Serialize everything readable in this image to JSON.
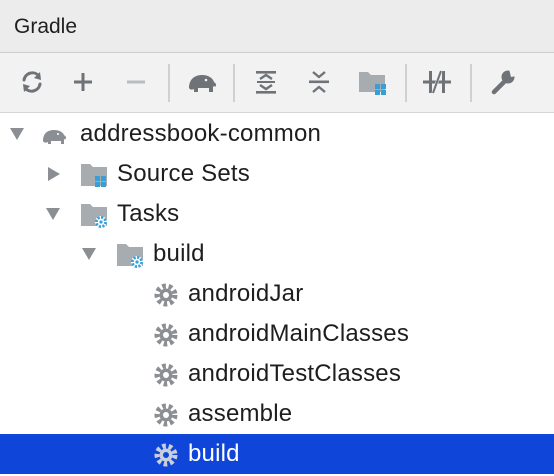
{
  "panel": {
    "title": "Gradle"
  },
  "toolbar": {
    "buttons": [
      {
        "name": "refresh-icon"
      },
      {
        "name": "add-icon"
      },
      {
        "name": "remove-icon"
      },
      {
        "name": "gradle-elephant-icon"
      },
      {
        "name": "expand-all-icon"
      },
      {
        "name": "collapse-all-icon"
      },
      {
        "name": "group-modules-icon"
      },
      {
        "name": "toggle-offline-icon"
      },
      {
        "name": "wrench-icon"
      }
    ]
  },
  "tree": {
    "items": [
      {
        "label": "addressbook-common",
        "icon": "gradle-elephant-icon",
        "expanded": true
      },
      {
        "label": "Source Sets",
        "icon": "source-sets-folder-icon",
        "expanded": false
      },
      {
        "label": "Tasks",
        "icon": "tasks-folder-icon",
        "expanded": true
      },
      {
        "label": "build",
        "icon": "task-group-folder-icon",
        "expanded": true
      },
      {
        "label": "androidJar",
        "icon": "gear-icon"
      },
      {
        "label": "androidMainClasses",
        "icon": "gear-icon"
      },
      {
        "label": "androidTestClasses",
        "icon": "gear-icon"
      },
      {
        "label": "assemble",
        "icon": "gear-icon"
      },
      {
        "label": "build",
        "icon": "gear-icon",
        "selected": true
      }
    ]
  },
  "colors": {
    "selection": "#0f45d8",
    "icon_gray": "#6f7378",
    "icon_blue": "#389fd6",
    "header_bg": "#ececec"
  }
}
